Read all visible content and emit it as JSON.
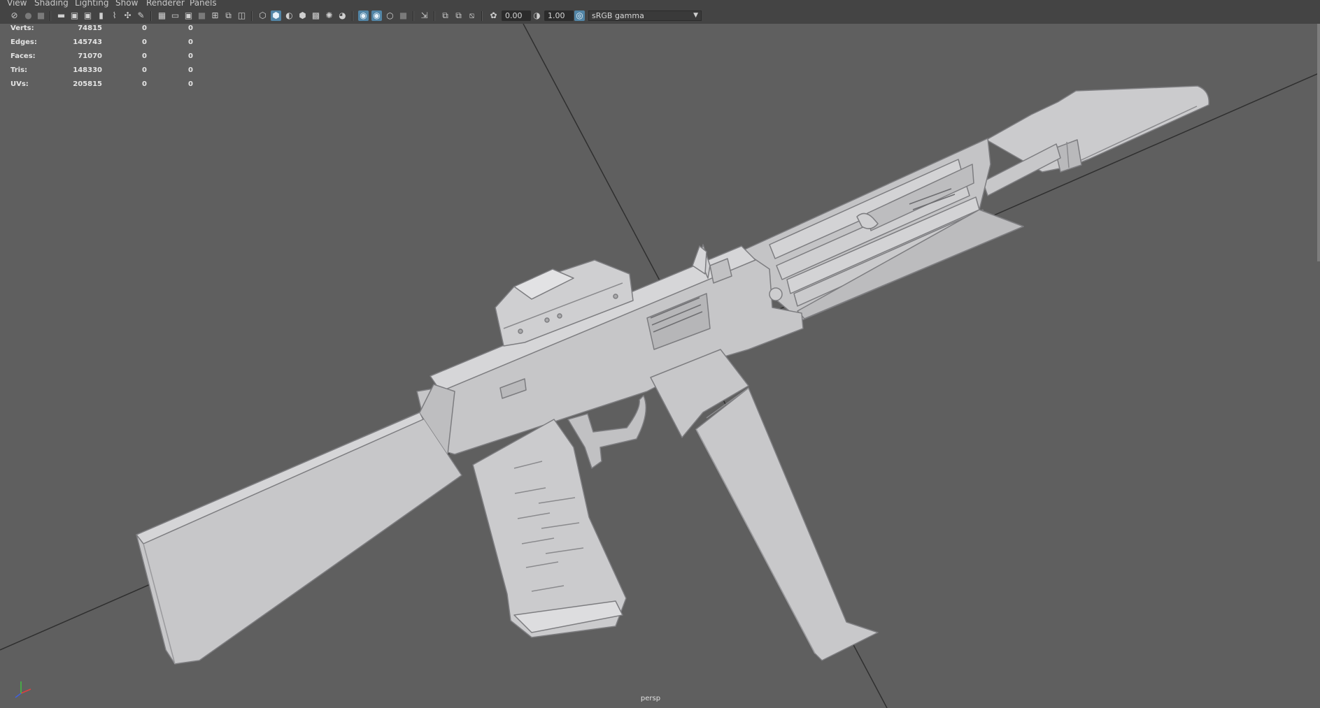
{
  "menubar": {
    "items": [
      "View",
      "Shading",
      "Lighting",
      "Show",
      "Renderer",
      "Panels"
    ]
  },
  "toolbar": {
    "exposure_value": "0.00",
    "gamma_value": "1.00",
    "color_space": "sRGB gamma",
    "icons": [
      "select-camera-icon",
      "lock-camera-icon",
      "camera-attributes-icon",
      "bookmark-icon",
      "image-plane-icon",
      "2d-pan-zoom-icon",
      "grease-pencil-icon",
      "grid-icon",
      "film-gate-icon",
      "resolution-gate-icon",
      "gate-mask-icon",
      "field-chart-icon",
      "safe-action-icon",
      "safe-title-icon",
      "wireframe-icon",
      "smooth-shade-icon",
      "default-material-icon",
      "shaded-wireframe-icon",
      "textured-icon",
      "lighting-icon",
      "shadows-icon",
      "ambient-occlusion-icon",
      "antialiasing-icon",
      "depth-of-field-icon",
      "xray-icon",
      "xray-joints-icon",
      "isolate-select-icon",
      "exposure-icon",
      "gamma-icon",
      "color-management-icon"
    ]
  },
  "hud": {
    "rows": [
      {
        "label": "Verts:",
        "v1": "74815",
        "v2": "0",
        "v3": "0"
      },
      {
        "label": "Edges:",
        "v1": "145743",
        "v2": "0",
        "v3": "0"
      },
      {
        "label": "Faces:",
        "v1": "71070",
        "v2": "0",
        "v3": "0"
      },
      {
        "label": "Tris:",
        "v1": "148330",
        "v2": "0",
        "v3": "0"
      },
      {
        "label": "UVs:",
        "v1": "205815",
        "v2": "0",
        "v3": "0"
      }
    ]
  },
  "viewport": {
    "camera": "persp",
    "background": "#5f5f5f",
    "model_color": "#c9c9cb"
  }
}
